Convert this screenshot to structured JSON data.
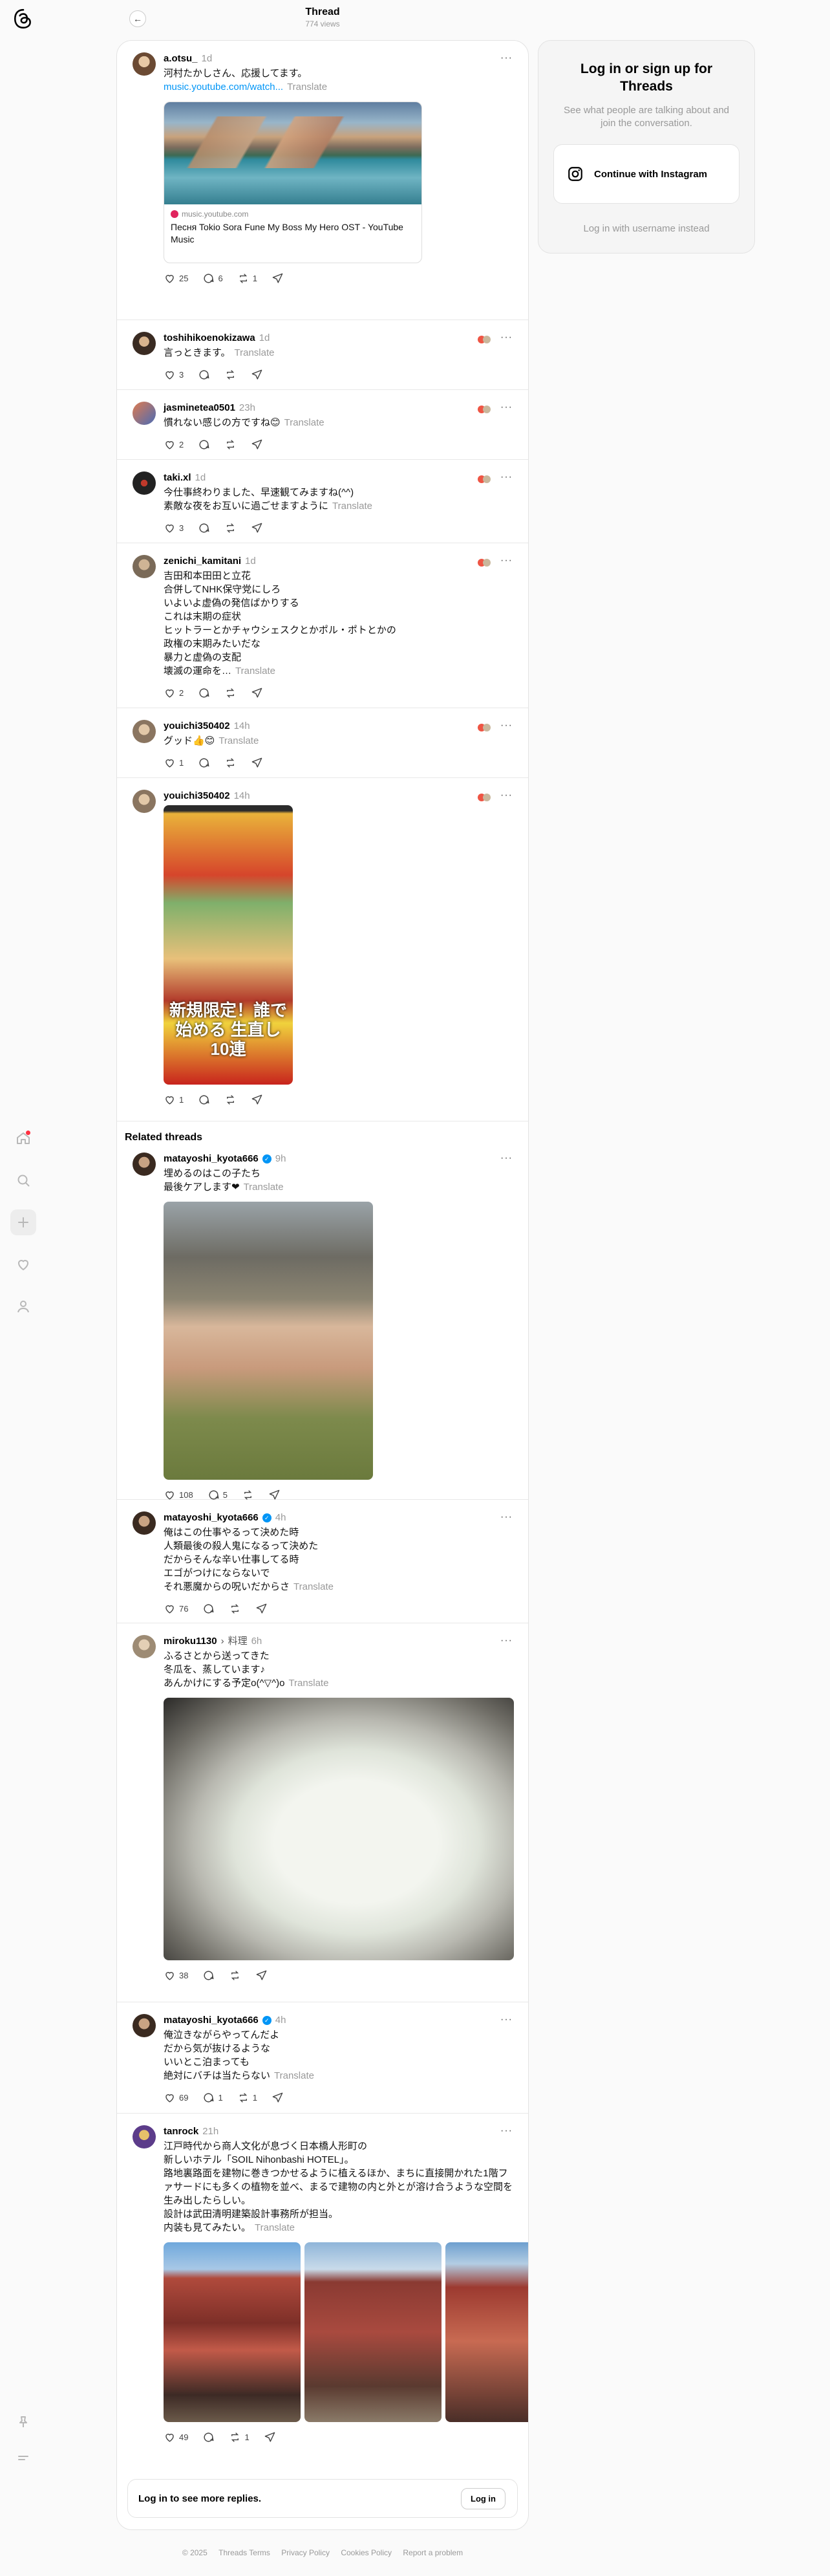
{
  "header": {
    "title": "Thread",
    "views": "774 views"
  },
  "root_post": {
    "username": "a.otsu_",
    "time": "1d",
    "text": "河村たかしさん、応援してます。",
    "link": "music.youtube.com/watch...",
    "translate": "Translate",
    "card": {
      "domain": "music.youtube.com",
      "title": "Песня Tokio Sora Fune My Boss My Hero OST - YouTube Music"
    },
    "likes": "25",
    "replies": "6",
    "reposts": "1"
  },
  "replies": [
    {
      "username": "toshihikoenokizawa",
      "time": "1d",
      "text": "言っときます。",
      "likes": "3"
    },
    {
      "username": "jasminetea0501",
      "time": "23h",
      "text": "慣れない感じの方ですね😊",
      "likes": "2"
    },
    {
      "username": "taki.xl",
      "time": "1d",
      "text": "今仕事終わりました、早速観てみますね(^^)\n素敵な夜をお互いに過ごせますように",
      "likes": "3"
    },
    {
      "username": "zenichi_kamitani",
      "time": "1d",
      "text": "吉田和本田田と立花\n合併してNHK保守党にしろ\nいよいよ虚偽の発信ばかりする\nこれは末期の症状\nヒットラーとかチャウシェスクとかポル・ポトとかの\n政権の末期みたいだな\n暴力と虚偽の支配\n壊滅の運命を…",
      "likes": "2"
    },
    {
      "username": "youichi350402",
      "time": "14h",
      "text": "グッド👍😊",
      "likes": "1"
    },
    {
      "username": "youichi350402",
      "time": "14h",
      "text": "",
      "likes": "1",
      "image_caption": "新規限定！誰で始める 生直し10連"
    }
  ],
  "related_label": "Related threads",
  "related": [
    {
      "username": "matayoshi_kyota666",
      "time": "9h",
      "text": "埋めるのはこの子たち\n最後ケアします❤",
      "likes": "108",
      "replies": "5"
    },
    {
      "username": "matayoshi_kyota666",
      "time": "4h",
      "text": "俺はこの仕事やるって決めた時\n人類最後の殺人鬼になるって決めた\nだからそんな辛い仕事してる時\nエゴがつけにならないで\nそれ悪魔からの呪いだからさ",
      "likes": "76"
    },
    {
      "username": "miroku1130",
      "topic": "料理",
      "time": "6h",
      "text": "ふるさとから送ってきた\n冬瓜を、蒸しています♪\nあんかけにする予定o(^▽^)o",
      "likes": "38"
    },
    {
      "username": "matayoshi_kyota666",
      "time": "4h",
      "text": "俺泣きながらやってんだよ\nだから気が抜けるような\nいいとこ泊まっても\n絶対にバチは当たらない",
      "likes": "69",
      "replies": "1",
      "reposts": "1"
    },
    {
      "username": "tanrock",
      "time": "21h",
      "text": "江戸時代から商人文化が息づく日本橋人形町の\n新しいホテル「SOIL Nihonbashi HOTEL」。\n路地裏路面を建物に巻きつかせるように植えるほか、まちに直接開かれた1階フ\nァサードにも多くの植物を並べ、まるで建物の内と外とが溶け合うような空間を\n生み出したらしい。\n設計は武田清明建築設計事務所が担当。\n内装も見てみたい。",
      "likes": "49",
      "reposts": "1"
    }
  ],
  "translate": "Translate",
  "login_bar": {
    "text": "Log in to see more replies.",
    "button": "Log in"
  },
  "right_card": {
    "title": "Log in or sign up for Threads",
    "subtitle": "See what people are talking about and join the conversation.",
    "instagram": "Continue with Instagram",
    "alt": "Log in with username instead"
  },
  "footer": [
    "© 2025",
    "Threads Terms",
    "Privacy Policy",
    "Cookies Policy",
    "Report a problem"
  ],
  "icons": [
    "threads-logo-icon",
    "home-icon",
    "search-icon",
    "plus-icon",
    "heart-icon",
    "profile-icon",
    "pin-icon",
    "menu-icon"
  ],
  "colors": {
    "accent": "#0095f6",
    "notification": "#ff3040"
  }
}
